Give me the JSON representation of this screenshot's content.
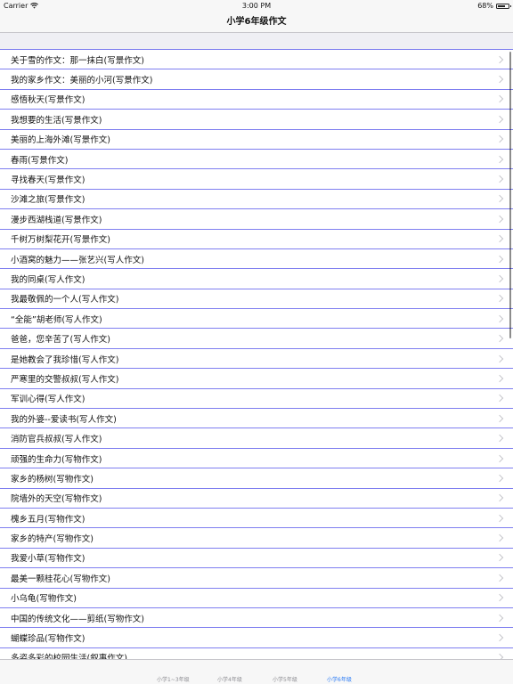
{
  "status_bar": {
    "carrier": "Carrier",
    "time": "3:00 PM",
    "battery": "68%"
  },
  "nav": {
    "title": "小学6年级作文"
  },
  "list": {
    "items": [
      "关于雪的作文：那一抹白(写景作文)",
      "我的家乡作文：美丽的小河(写景作文)",
      "感悟秋天(写景作文)",
      "我想要的生活(写景作文)",
      "美丽的上海外滩(写景作文)",
      "春雨(写景作文)",
      "寻找春天(写景作文)",
      "沙滩之旅(写景作文)",
      "漫步西湖栈道(写景作文)",
      "千树万树梨花开(写景作文)",
      "小酒窝的魅力——张艺兴(写人作文)",
      "我的同桌(写人作文)",
      "我最敬佩的一个人(写人作文)",
      "“全能”胡老师(写人作文)",
      "爸爸，您辛苦了(写人作文)",
      "是她教会了我珍惜(写人作文)",
      "严寒里的交警叔叔(写人作文)",
      "军训心得(写人作文)",
      "我的外婆--爱读书(写人作文)",
      "消防官兵叔叔(写人作文)",
      "顽强的生命力(写物作文)",
      "家乡的杨树(写物作文)",
      "院墙外的天空(写物作文)",
      "槐乡五月(写物作文)",
      "家乡的特产(写物作文)",
      "我爱小草(写物作文)",
      "最美一颗桂花心(写物作文)",
      "小乌龟(写物作文)",
      "中国的传统文化——剪纸(写物作文)",
      "蝴蝶珍品(写物作文)",
      "多姿多彩的校园生活(叙事作文)"
    ]
  },
  "tabs": [
    {
      "label": "小学1~3年级"
    },
    {
      "label": "小学4年级"
    },
    {
      "label": "小学5年级"
    },
    {
      "label": "小学6年级"
    }
  ],
  "colors": {
    "separator": "#7e7ef0",
    "active_tab": "#2b7bf5",
    "inactive_tab": "#8e8e93"
  }
}
